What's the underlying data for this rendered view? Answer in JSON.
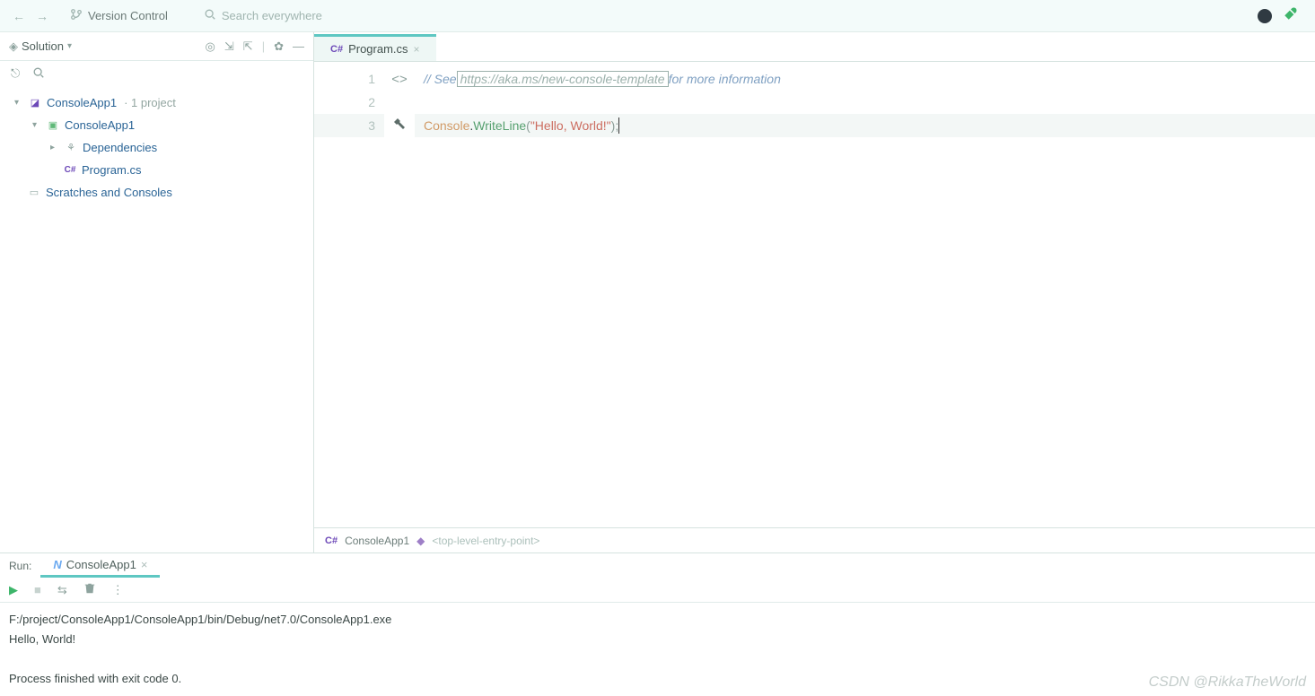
{
  "top": {
    "version_control": "Version Control",
    "search_placeholder": "Search everywhere"
  },
  "sidebar": {
    "title": "Solution",
    "tree": {
      "root_name": "ConsoleApp1",
      "root_suffix": "· 1 project",
      "project": "ConsoleApp1",
      "dependencies": "Dependencies",
      "file": "Program.cs",
      "file_prefix": "C#",
      "scratches": "Scratches and Consoles"
    }
  },
  "tab": {
    "prefix": "C#",
    "name": "Program.cs"
  },
  "code": {
    "line1_a": "// See ",
    "line1_link": "https://aka.ms/new-console-template",
    "line1_b": " for more information",
    "l1": "1",
    "l2": "2",
    "l3": "3",
    "console": "Console",
    "dot": ".",
    "writeline": "WriteLine",
    "open": "(",
    "str": "\"Hello, World!\"",
    "close": ")",
    "semi": ";"
  },
  "breadcrumb": {
    "prefix": "C#",
    "project": "ConsoleApp1",
    "entry": "<top-level-entry-point>"
  },
  "run": {
    "label": "Run:",
    "tab": "ConsoleApp1",
    "out_path": "F:/project/ConsoleApp1/ConsoleApp1/bin/Debug/net7.0/ConsoleApp1.exe",
    "out_hello": "Hello, World!",
    "out_exit": "Process finished with exit code 0."
  },
  "watermark": "CSDN @RikkaTheWorld"
}
